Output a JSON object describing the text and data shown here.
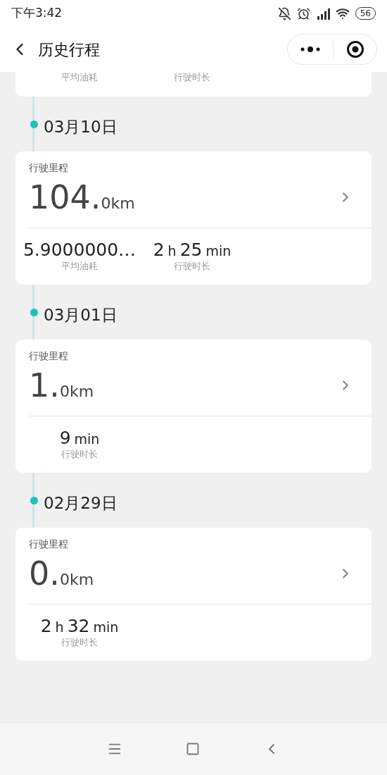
{
  "status_bar": {
    "time": "下午3:42",
    "battery": "56"
  },
  "nav": {
    "title": "历史行程"
  },
  "partial_trip": {
    "stats": [
      "平均油耗",
      "行驶时长"
    ]
  },
  "trips": [
    {
      "date": "03月10日",
      "distance_label": "行驶里程",
      "distance_whole": "104.",
      "distance_rest": "0km",
      "stats": [
        {
          "parts": [
            {
              "kind": "number",
              "text": "5.9000000…"
            }
          ],
          "label": "平均油耗"
        },
        {
          "parts": [
            {
              "kind": "number",
              "text": "2"
            },
            {
              "kind": "unit",
              "text": "h"
            },
            {
              "kind": "number",
              "text": "25"
            },
            {
              "kind": "unit",
              "text": "min"
            }
          ],
          "label": "行驶时长"
        }
      ]
    },
    {
      "date": "03月01日",
      "distance_label": "行驶里程",
      "distance_whole": "1.",
      "distance_rest": "0km",
      "stats": [
        {
          "parts": [
            {
              "kind": "number",
              "text": "9"
            },
            {
              "kind": "unit",
              "text": "min"
            }
          ],
          "label": "行驶时长"
        }
      ]
    },
    {
      "date": "02月29日",
      "distance_label": "行驶里程",
      "distance_whole": "0.",
      "distance_rest": "0km",
      "stats": [
        {
          "parts": [
            {
              "kind": "number",
              "text": "2"
            },
            {
              "kind": "unit",
              "text": "h"
            },
            {
              "kind": "number",
              "text": "32"
            },
            {
              "kind": "unit",
              "text": "min"
            }
          ],
          "label": "行驶时长"
        }
      ]
    }
  ]
}
